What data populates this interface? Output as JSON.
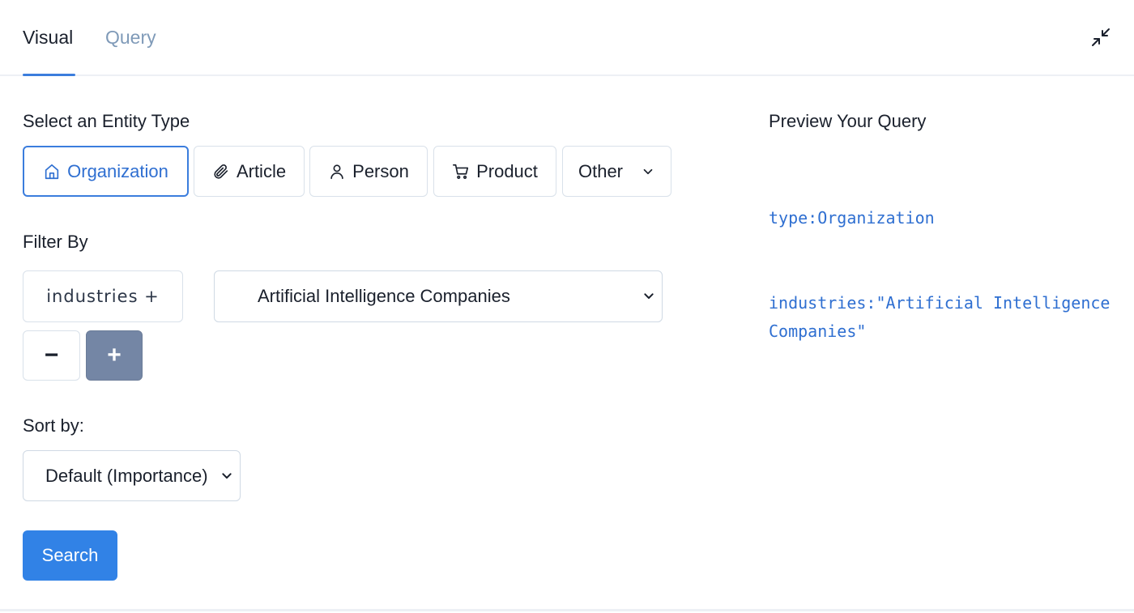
{
  "tabs": [
    {
      "label": "Visual",
      "active": true
    },
    {
      "label": "Query",
      "active": false
    }
  ],
  "header": {
    "collapse_icon": "collapse-arrows-icon"
  },
  "entity_section": {
    "label": "Select an Entity Type",
    "types": [
      {
        "label": "Organization",
        "icon": "home-icon",
        "selected": true
      },
      {
        "label": "Article",
        "icon": "paperclip-icon",
        "selected": false
      },
      {
        "label": "Person",
        "icon": "person-icon",
        "selected": false
      },
      {
        "label": "Product",
        "icon": "cart-icon",
        "selected": false
      },
      {
        "label": "Other",
        "icon": "chevron-down-icon",
        "selected": false
      }
    ]
  },
  "filter_section": {
    "label": "Filter By",
    "key_label": "industries +",
    "value": "Artificial Intelligence Companies",
    "minus_label": "−",
    "plus_label": "+"
  },
  "sort_section": {
    "label": "Sort by:",
    "value": "Default (Importance)"
  },
  "search_button": {
    "label": "Search"
  },
  "preview": {
    "label": "Preview Your Query",
    "lines": [
      "type:Organization",
      "industries:\"Artificial Intelligence Companies\""
    ]
  },
  "colors": {
    "accent": "#3b7ddd",
    "search_button": "#3182e6",
    "plus_button": "#7486a5",
    "code_text": "#2f6fd1",
    "inactive_tab": "#7f9ab8"
  }
}
